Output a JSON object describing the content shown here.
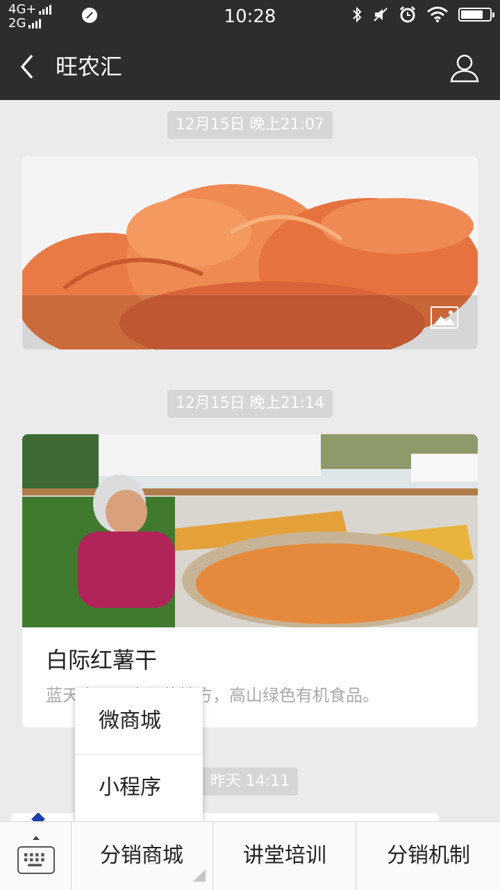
{
  "status_bar": {
    "network_1": "4G+",
    "network_2": "2G",
    "time": "10:28"
  },
  "nav": {
    "title": "旺农汇",
    "icons": [
      "back-chevron-icon",
      "profile-icon"
    ]
  },
  "messages": [
    {
      "timestamp": "12月15日 晚上21:07"
    },
    {
      "timestamp": "12月15日 晚上21:14",
      "title": "白际红薯干",
      "description": "蓝天白云下方阳的地方，高山绿色有机食品。"
    },
    {
      "timestamp": "昨天 14:11"
    }
  ],
  "popup_menu": {
    "items": [
      "微商城",
      "小程序"
    ]
  },
  "bottom_menu": {
    "items": [
      "分销商城",
      "讲堂培训",
      "分销机制"
    ]
  },
  "colors": {
    "bar_bg": "#2d2d2d",
    "chat_bg": "#ebebeb",
    "timestamp_bg": "#d6d6d6"
  }
}
